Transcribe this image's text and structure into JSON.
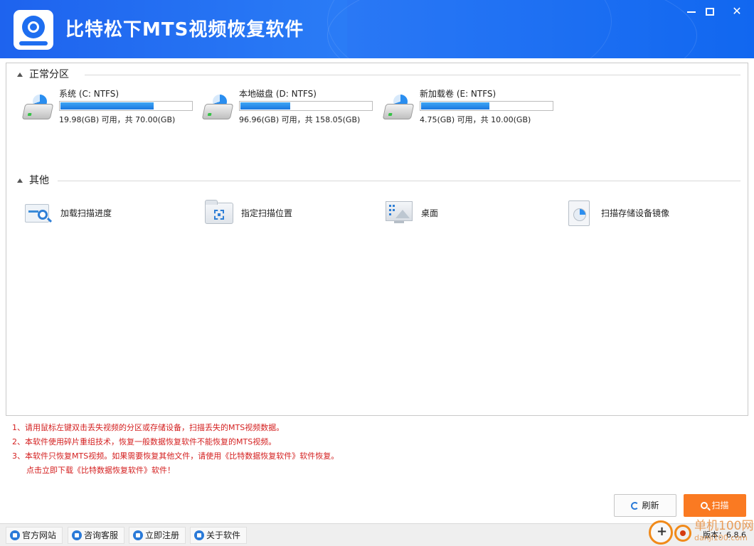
{
  "window": {
    "title": "比特松下MTS视频恢复软件",
    "min_label": "minimize",
    "max_label": "maximize",
    "close_label": "close"
  },
  "normal_section": {
    "label": "正常分区",
    "drives": [
      {
        "name": "系统 (C: NTFS)",
        "info": "19.98(GB) 可用，共 70.00(GB)",
        "used_fraction": 0.715
      },
      {
        "name": "本地磁盘 (D: NTFS)",
        "info": "96.96(GB) 可用，共 158.05(GB)",
        "used_fraction": 0.387
      },
      {
        "name": "新加载卷 (E: NTFS)",
        "info": "4.75(GB) 可用，共 10.00(GB)",
        "used_fraction": 0.525
      }
    ]
  },
  "other_section": {
    "label": "其他",
    "items": [
      {
        "label": "加载扫描进度",
        "icon": "scan-progress-icon"
      },
      {
        "label": "指定扫描位置",
        "icon": "folder-target-icon"
      },
      {
        "label": "桌面",
        "icon": "desktop-icon"
      },
      {
        "label": "扫描存储设备镜像",
        "icon": "disk-image-icon"
      }
    ]
  },
  "tips": [
    "1、请用鼠标左键双击丢失视频的分区或存储设备，扫描丢失的MTS视频数据。",
    "2、本软件使用碎片重组技术，恢复一般数据恢复软件不能恢复的MTS视频。",
    "3、本软件只恢复MTS视频。如果需要恢复其他文件，请使用《比特数据恢复软件》软件恢复。",
    "点击立即下载《比特数据恢复软件》软件！"
  ],
  "buttons": {
    "refresh": "刷新",
    "scan": "扫描"
  },
  "bottom_links": [
    {
      "label": "官方网站",
      "icon": "home-icon"
    },
    {
      "label": "咨询客服",
      "icon": "support-icon"
    },
    {
      "label": "立即注册",
      "icon": "register-icon"
    },
    {
      "label": "关于软件",
      "icon": "info-icon"
    }
  ],
  "version": "版本：6.8.6",
  "watermark": {
    "text": "单机100网",
    "sub": "danji100.com"
  },
  "colors": {
    "titlebar": "#1f6ef2",
    "scan_button": "#fa7a22",
    "tips": "#d42020",
    "progress": "#2a8ef0"
  }
}
